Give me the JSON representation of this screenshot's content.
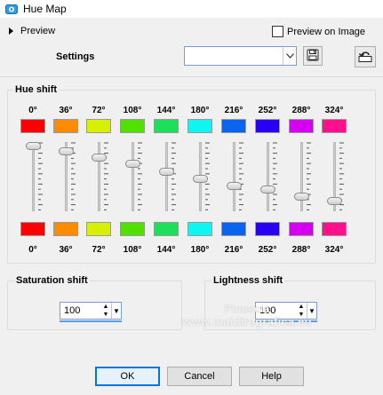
{
  "window": {
    "title": "Hue Map"
  },
  "preview": {
    "label": "Preview",
    "on_image_label": "Preview on Image",
    "on_image_checked": false
  },
  "settings": {
    "label": "Settings",
    "value": ""
  },
  "hue_shift": {
    "title": "Hue shift",
    "columns": [
      {
        "top_label": "0°",
        "bottom_label": "0°",
        "top_color": "#ff0000",
        "bottom_color": "#ff0000",
        "level": 0.05
      },
      {
        "top_label": "36°",
        "bottom_label": "36°",
        "top_color": "#ff8c00",
        "bottom_color": "#ff8c00",
        "level": 0.13
      },
      {
        "top_label": "72°",
        "bottom_label": "72°",
        "top_color": "#d7f000",
        "bottom_color": "#d7f000",
        "level": 0.23
      },
      {
        "top_label": "108°",
        "bottom_label": "108°",
        "top_color": "#52e000",
        "bottom_color": "#52e000",
        "level": 0.32
      },
      {
        "top_label": "144°",
        "bottom_label": "144°",
        "top_color": "#1ddf5a",
        "bottom_color": "#1ddf5a",
        "level": 0.45
      },
      {
        "top_label": "180°",
        "bottom_label": "180°",
        "top_color": "#0ff5f0",
        "bottom_color": "#0ff5f0",
        "level": 0.55
      },
      {
        "top_label": "216°",
        "bottom_label": "216°",
        "top_color": "#0a64f0",
        "bottom_color": "#0a64f0",
        "level": 0.66
      },
      {
        "top_label": "252°",
        "bottom_label": "252°",
        "top_color": "#2a00f5",
        "bottom_color": "#2a00f5",
        "level": 0.72
      },
      {
        "top_label": "288°",
        "bottom_label": "288°",
        "top_color": "#d400f0",
        "bottom_color": "#d400f0",
        "level": 0.82
      },
      {
        "top_label": "324°",
        "bottom_label": "324°",
        "top_color": "#ff0f8c",
        "bottom_color": "#ff0f8c",
        "level": 0.89
      }
    ]
  },
  "saturation_shift": {
    "title": "Saturation shift",
    "value": "100"
  },
  "lightness_shift": {
    "title": "Lightness shift",
    "value": "100"
  },
  "buttons": {
    "ok": "OK",
    "cancel": "Cancel",
    "help": "Help"
  },
  "watermark": {
    "name": "Pinuccia",
    "url": "www.maldiregrafica.eu"
  },
  "icons": {
    "app": "hue-map-app-icon",
    "expand": "triangle-right-icon",
    "dropdown": "chevron-down-icon",
    "save": "floppy-disk-icon",
    "reset": "reset-arrow-icon"
  }
}
